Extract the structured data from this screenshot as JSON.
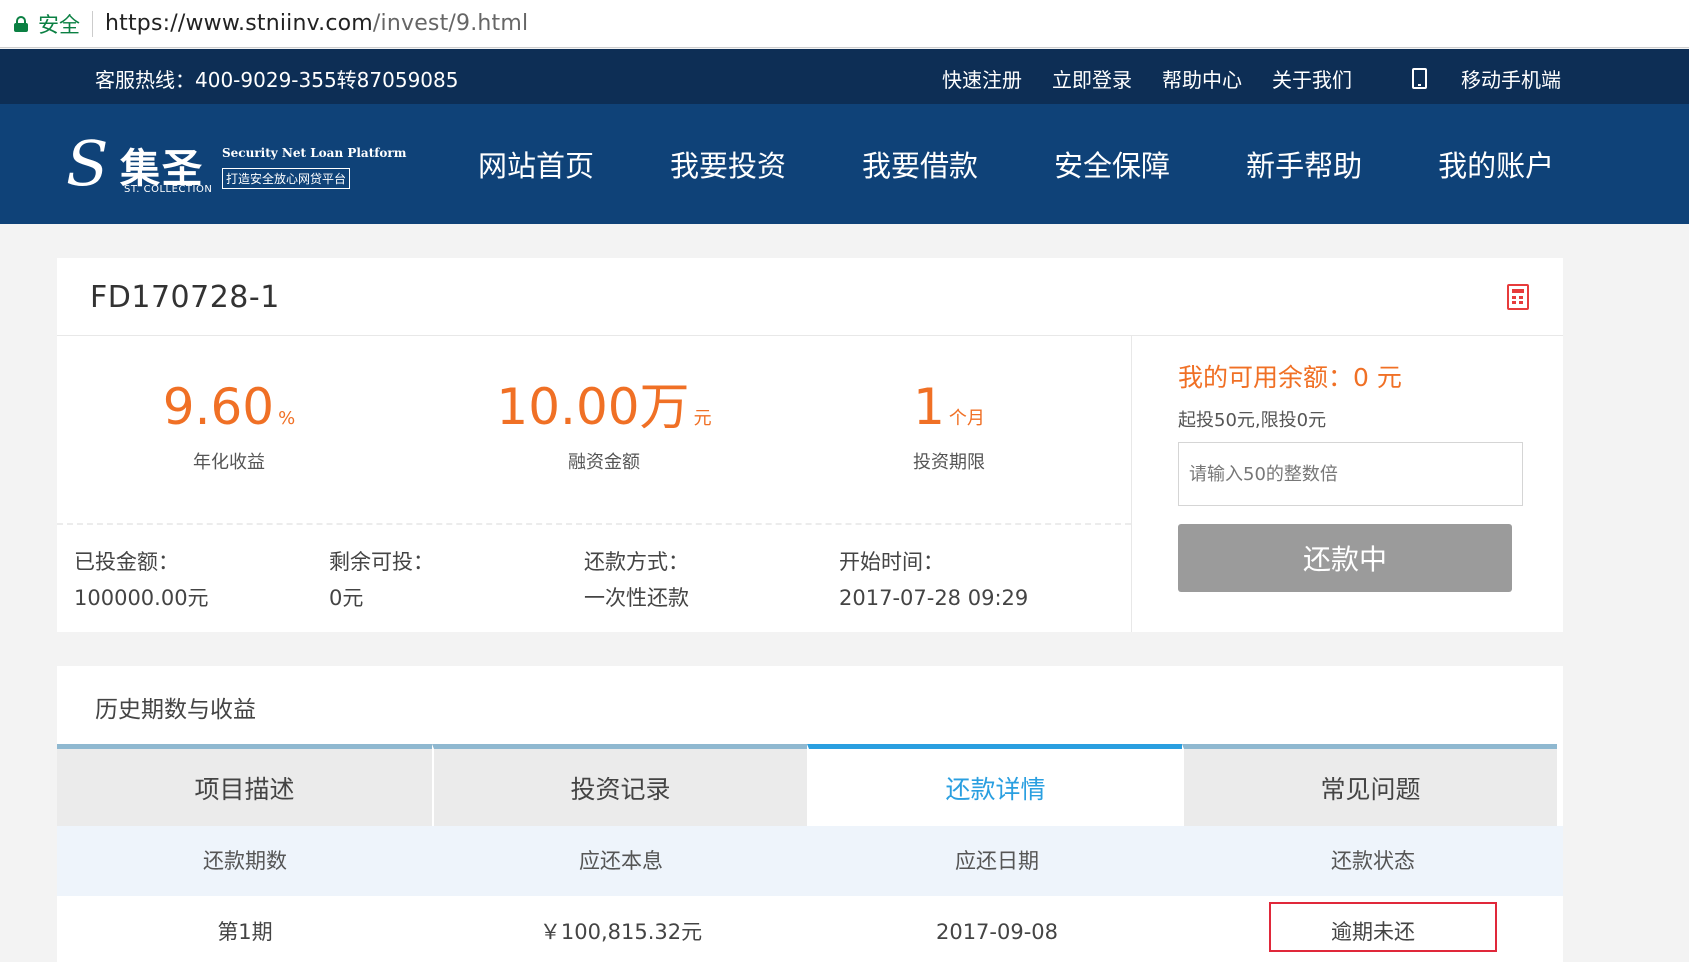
{
  "browser": {
    "secure_label": "安全",
    "url_host": "https://www.stniinv.com",
    "url_path": "/invest/9.html"
  },
  "topbar": {
    "hotline": "客服热线：400-9029-355转87059085",
    "links": [
      "快速注册",
      "立即登录",
      "帮助中心",
      "关于我们"
    ],
    "mobile_label": "移动手机端"
  },
  "logo": {
    "mark": "S",
    "cn_name": "集圣",
    "en_small": "ST. COLLECTION",
    "en_name": "Security Net Loan Platform",
    "slogan": "打造安全放心网贷平台"
  },
  "nav": [
    "网站首页",
    "我要投资",
    "我要借款",
    "安全保障",
    "新手帮助",
    "我的账户"
  ],
  "product": {
    "code": "FD170728-1",
    "rate": {
      "value": "9.60",
      "unit": "%",
      "label": "年化收益"
    },
    "amount": {
      "value": "10.00万",
      "unit": "元",
      "label": "融资金额"
    },
    "term": {
      "value": "1",
      "unit": "个月",
      "label": "投资期限"
    },
    "invested_label": "已投金额：",
    "invested_value": "100000.00元",
    "remaining_label": "剩余可投：",
    "remaining_value": "0元",
    "repay_label": "还款方式：",
    "repay_value": "一次性还款",
    "start_label": "开始时间：",
    "start_value": "2017-07-28 09:29"
  },
  "invest_panel": {
    "balance": "我的可用余额：0 元",
    "limit": "起投50元,限投0元",
    "input_placeholder": "请输入50的整数倍",
    "status_button": "还款中"
  },
  "history": {
    "title": "历史期数与收益",
    "tabs": [
      "项目描述",
      "投资记录",
      "还款详情",
      "常见问题"
    ],
    "active_tab": 2,
    "columns": [
      "还款期数",
      "应还本息",
      "应还日期",
      "还款状态"
    ],
    "rows": [
      {
        "period": "第1期",
        "amount": "￥100,815.32元",
        "date": "2017-09-08",
        "status": "逾期未还"
      }
    ]
  },
  "colors": {
    "accent_orange": "#f07025",
    "nav_blue": "#0f4278",
    "tab_active": "#2a9fe0",
    "highlight_red": "#e0283a"
  }
}
